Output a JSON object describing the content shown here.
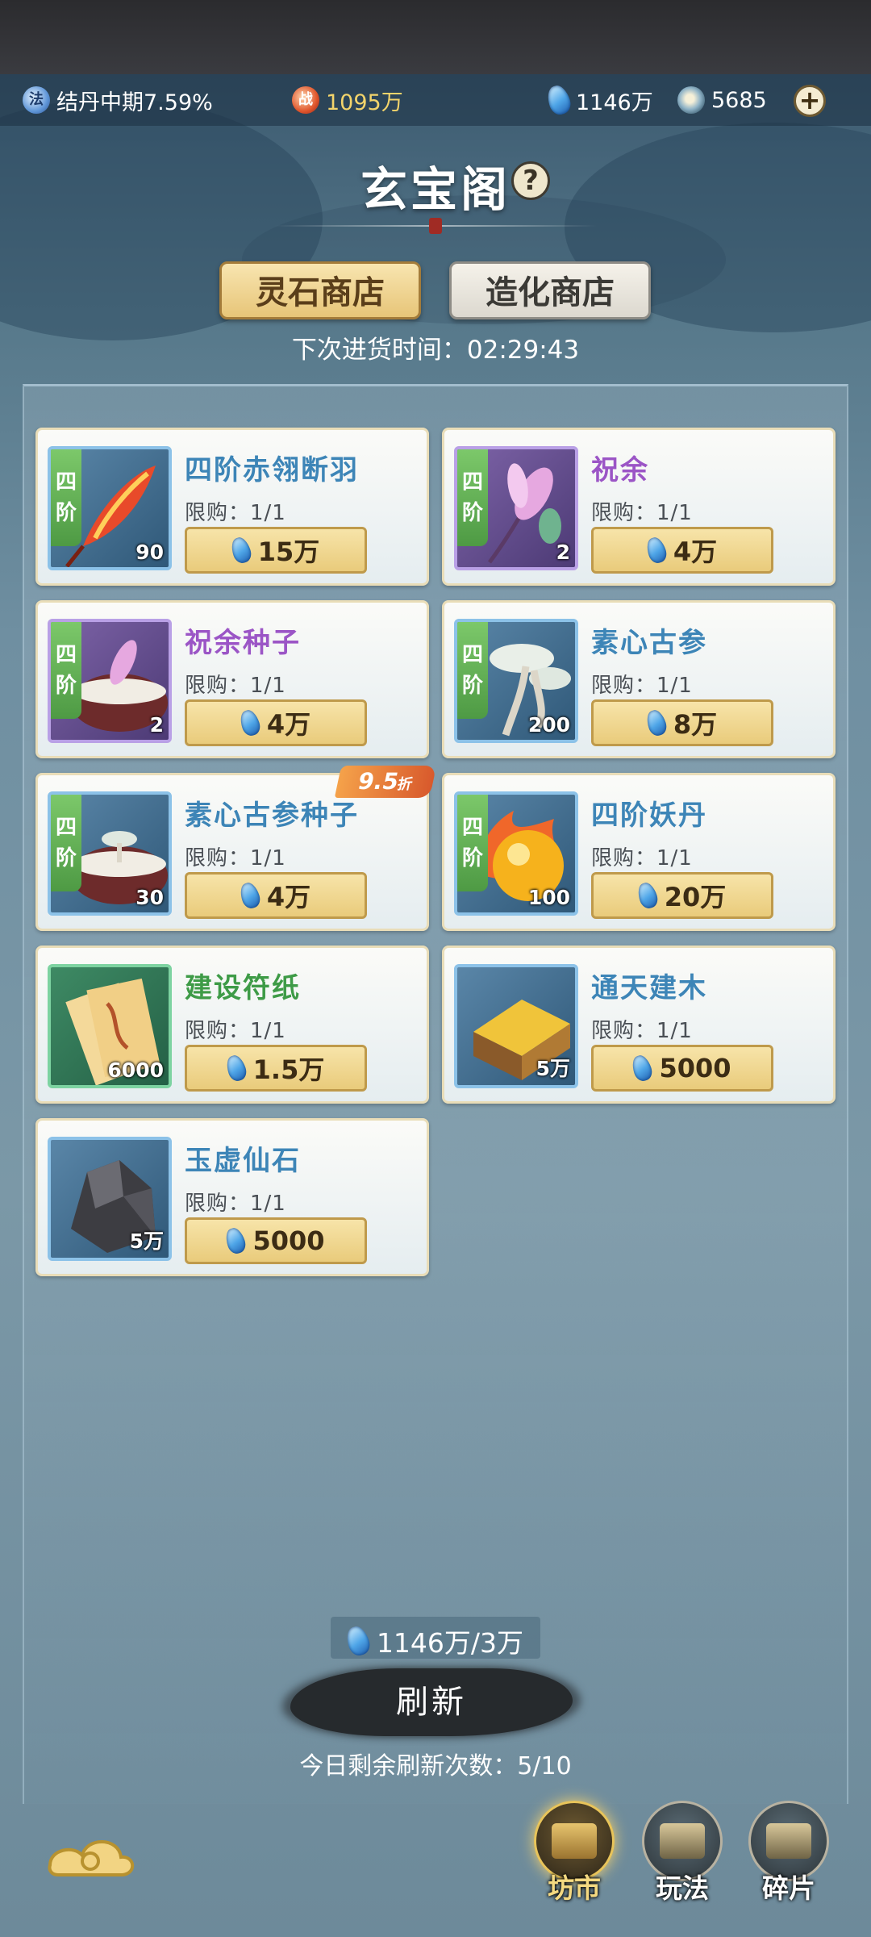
{
  "header": {
    "realm": "结丹中期7.59%",
    "realm_icon": "法",
    "power_icon": "战",
    "power": "1095万",
    "spirit_stones": "1146万",
    "coins": "5685",
    "plus": "+"
  },
  "title": "玄宝阁",
  "help": "?",
  "tabs": [
    {
      "label": "灵石商店",
      "active": true
    },
    {
      "label": "造化商店",
      "active": false
    }
  ],
  "restock_text": "下次进货时间：02:29:43",
  "items": [
    {
      "name": "四阶赤翎断羽",
      "tier": [
        "四",
        "阶"
      ],
      "qty": "90",
      "limit": "限购：1/1",
      "price": "15万",
      "color": "blue",
      "frame": "blue"
    },
    {
      "name": "祝余",
      "tier": [
        "四",
        "阶"
      ],
      "qty": "2",
      "limit": "限购：1/1",
      "price": "4万",
      "color": "purple",
      "frame": "purple"
    },
    {
      "name": "祝余种子",
      "tier": [
        "四",
        "阶"
      ],
      "qty": "2",
      "limit": "限购：1/1",
      "price": "4万",
      "color": "purple",
      "frame": "purple"
    },
    {
      "name": "素心古参",
      "tier": [
        "四",
        "阶"
      ],
      "qty": "200",
      "limit": "限购：1/1",
      "price": "8万",
      "color": "blue",
      "frame": "blue"
    },
    {
      "name": "素心古参种子",
      "tier": [
        "四",
        "阶"
      ],
      "qty": "30",
      "limit": "限购：1/1",
      "price": "4万",
      "color": "blue",
      "frame": "blue",
      "discount": "9.5",
      "discount_unit": "折"
    },
    {
      "name": "四阶妖丹",
      "tier": [
        "四",
        "阶"
      ],
      "qty": "100",
      "limit": "限购：1/1",
      "price": "20万",
      "color": "blue",
      "frame": "blue"
    },
    {
      "name": "建设符纸",
      "qty": "6000",
      "limit": "限购：1/1",
      "price": "1.5万",
      "color": "green",
      "frame": "green"
    },
    {
      "name": "通天建木",
      "qty": "5万",
      "limit": "限购：1/1",
      "price": "5000",
      "color": "blue",
      "frame": "blue"
    },
    {
      "name": "玉虚仙石",
      "qty": "5万",
      "limit": "限购：1/1",
      "price": "5000",
      "color": "blue",
      "frame": "blue"
    }
  ],
  "refresh": {
    "cost": "1146万/3万",
    "label": "刷新",
    "remaining": "今日剩余刷新次数：5/10"
  },
  "nav": [
    {
      "label": "坊市",
      "active": true
    },
    {
      "label": "玩法",
      "active": false
    },
    {
      "label": "碎片",
      "active": false
    }
  ]
}
